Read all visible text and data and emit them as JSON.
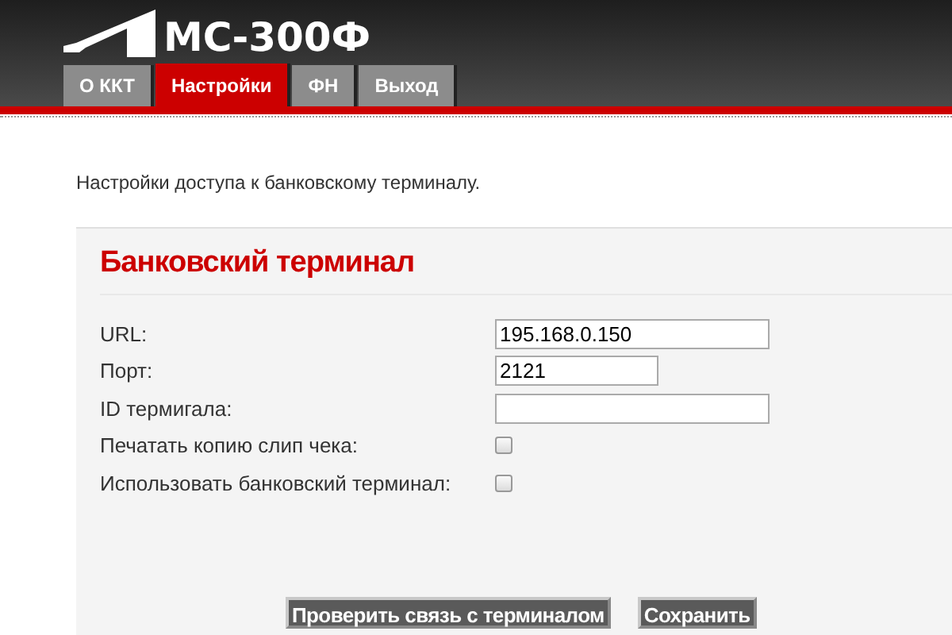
{
  "logo": {
    "text": "МС-300Ф"
  },
  "tabs": [
    {
      "label": "О ККТ",
      "selected": false
    },
    {
      "label": "Настройки",
      "selected": true
    },
    {
      "label": "ФН",
      "selected": false
    },
    {
      "label": "Выход",
      "selected": false
    }
  ],
  "intro": "Настройки доступа к банковскому терминалу.",
  "panel": {
    "title": "Банковский терминал",
    "fields": [
      {
        "kind": "text",
        "label": "URL:",
        "value": "195.168.0.150",
        "wide": true
      },
      {
        "kind": "text",
        "label": "Порт:",
        "value": "2121",
        "wide": false
      },
      {
        "kind": "text",
        "label": "ID термигала:",
        "wide": true
      },
      {
        "kind": "checkbox",
        "label": "Печатать копию слип чека:",
        "checked": false
      },
      {
        "kind": "checkbox",
        "label": "Использовать банковский терминал:",
        "checked": false
      }
    ],
    "buttons": [
      "Проверить связь с терминалом",
      "Сохранить"
    ]
  }
}
